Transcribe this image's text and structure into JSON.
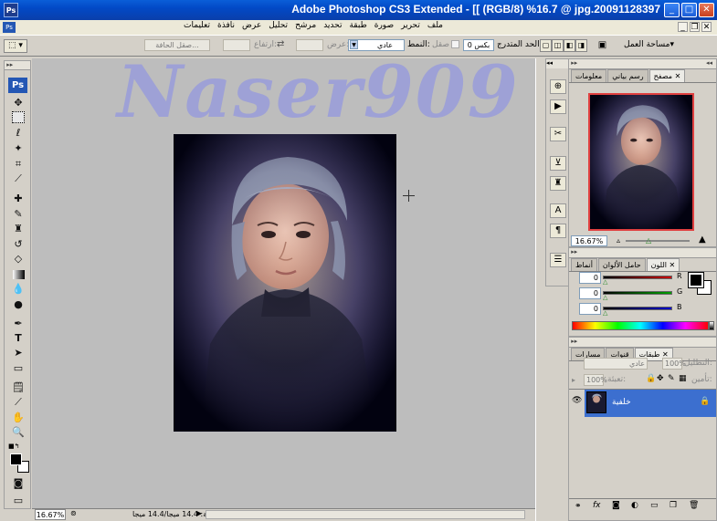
{
  "window": {
    "title": "Adobe Photoshop CS3 Extended - [[ (RGB/8) %16.7 @ jpg.20091128397",
    "app_icon": "Ps",
    "minimize": "_",
    "maximize": "□",
    "close": "✕"
  },
  "menu": {
    "items": [
      "ملف",
      "تحرير",
      "صورة",
      "طبقة",
      "تحديد",
      "مرشح",
      "تحليل",
      "عرض",
      "نافذة",
      "تعليمات"
    ],
    "doc_min": "_",
    "doc_restore": "❐",
    "doc_close": "✕"
  },
  "options": {
    "workspace_label": "مساحة العمل",
    "feather_label": "الحد المتدرج:",
    "feather_value": "0 بكس",
    "antialias_label": "صقل",
    "style_label": "النمط:",
    "style_value": "عادي",
    "width_label": "عرض:",
    "height_label": "ارتفاع:",
    "refine_edge": "صقل الحافة..."
  },
  "canvas": {
    "watermark": "Naser909",
    "background": "#bdbdbd",
    "watermark_color": "#9ea1d6"
  },
  "status": {
    "zoom": "16.67%",
    "doc_info": "وثيقة: 14.4 ميجا/14.4 ميجا"
  },
  "navigator": {
    "tabs": [
      "مصفح",
      "رسم بياني",
      "معلومات"
    ],
    "zoom": "16.67%"
  },
  "color": {
    "tabs": [
      "اللون",
      "حامل الألوان",
      "أنماط"
    ],
    "channels": [
      {
        "label": "R",
        "value": "0",
        "color": "#cc0000"
      },
      {
        "label": "G",
        "value": "0",
        "color": "#00a000"
      },
      {
        "label": "B",
        "value": "0",
        "color": "#0000cc"
      }
    ]
  },
  "layers": {
    "tabs": [
      "طبقات",
      "قنوات",
      "مسارات"
    ],
    "blend_mode": "عادي",
    "opacity_label": "التظليل:",
    "opacity_value": "100%",
    "fill_label": "تعبئة:",
    "fill_value": "100%",
    "lock_label": "تأمين:",
    "layer_name": "خلفية",
    "selection_color": "#3c6fcf"
  }
}
